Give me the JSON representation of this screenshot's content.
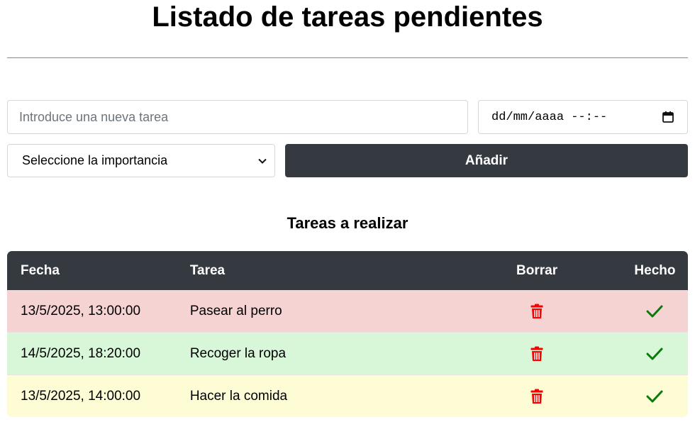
{
  "header": {
    "title": "Listado de tareas pendientes"
  },
  "form": {
    "task_placeholder": "Introduce una nueva tarea",
    "date_value": "dd/mm/aaaa --:--",
    "importance_selected": "Seleccione la importancia",
    "add_label": "Añadir"
  },
  "tasks_section": {
    "title": "Tareas a realizar",
    "columns": {
      "fecha": "Fecha",
      "tarea": "Tarea",
      "borrar": "Borrar",
      "hecho": "Hecho"
    },
    "rows": [
      {
        "fecha": "13/5/2025, 13:00:00",
        "tarea": "Pasear al perro",
        "row_color": "#f5d3d3"
      },
      {
        "fecha": "14/5/2025, 18:20:00",
        "tarea": "Recoger la ropa",
        "row_color": "#d8f6d8"
      },
      {
        "fecha": "13/5/2025, 14:00:00",
        "tarea": "Hacer la comida",
        "row_color": "#fdfcd4"
      }
    ]
  },
  "colors": {
    "dark": "#343a40",
    "delete_icon": "#ff0000",
    "done_icon": "#0a7a0a"
  },
  "icons": {
    "delete": "trash-icon",
    "done": "check-icon",
    "calendar": "calendar-icon",
    "select": "chevron-down-icon"
  }
}
